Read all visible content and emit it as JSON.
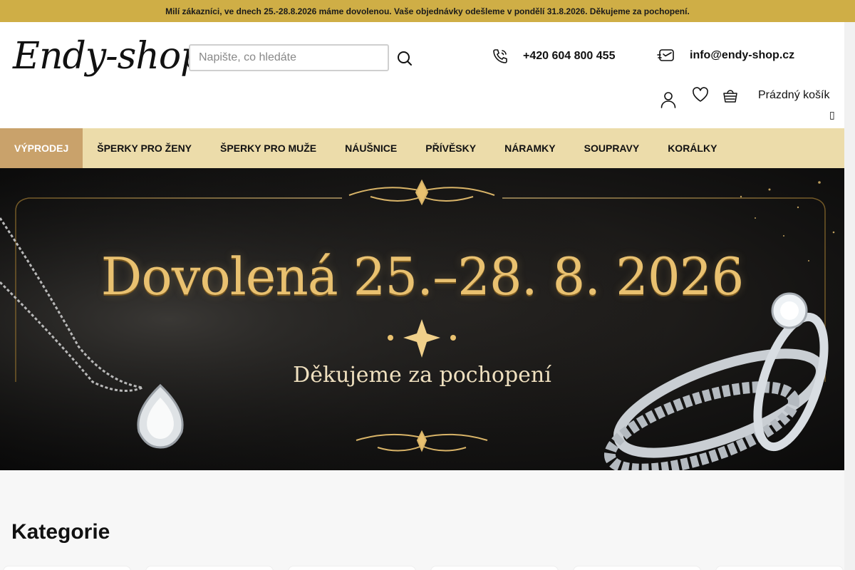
{
  "announcement": "Milí zákazníci, ve dnech 25.-28.8.2026 máme dovolenou. Vaše objednávky odešleme v pondělí 31.8.2026. Děkujeme za pochopení.",
  "header": {
    "logo": "Endy-shop",
    "search_placeholder": "Napište, co hledáte",
    "phone": "+420 604 800 455",
    "email": "info@endy-shop.cz",
    "cart_label": "Prázdný košík",
    "cart_sub_glyph": "▯"
  },
  "nav": {
    "items": [
      {
        "label": "VÝPRODEJ"
      },
      {
        "label": "ŠPERKY PRO ŽENY"
      },
      {
        "label": "ŠPERKY PRO MUŽE"
      },
      {
        "label": "NÁUŠNICE"
      },
      {
        "label": "PŘÍVĚSKY"
      },
      {
        "label": "NÁRAMKY"
      },
      {
        "label": "SOUPRAVY"
      },
      {
        "label": "KORÁLKY"
      }
    ]
  },
  "hero": {
    "title": "Dovolená 25.–28. 8. 2026",
    "subtitle": "Děkujeme za pochopení"
  },
  "categories": {
    "title": "Kategorie"
  },
  "icons": {
    "search": "search-icon",
    "phone": "phone-icon",
    "email": "email-icon",
    "user": "user-icon",
    "favorites": "heart-icon",
    "cart": "basket-icon"
  },
  "colors": {
    "announcement_bg": "#cfae46",
    "nav_bg": "#ecdcaa",
    "nav_active_bg": "#c9a26b",
    "gold": "#e9c170"
  }
}
